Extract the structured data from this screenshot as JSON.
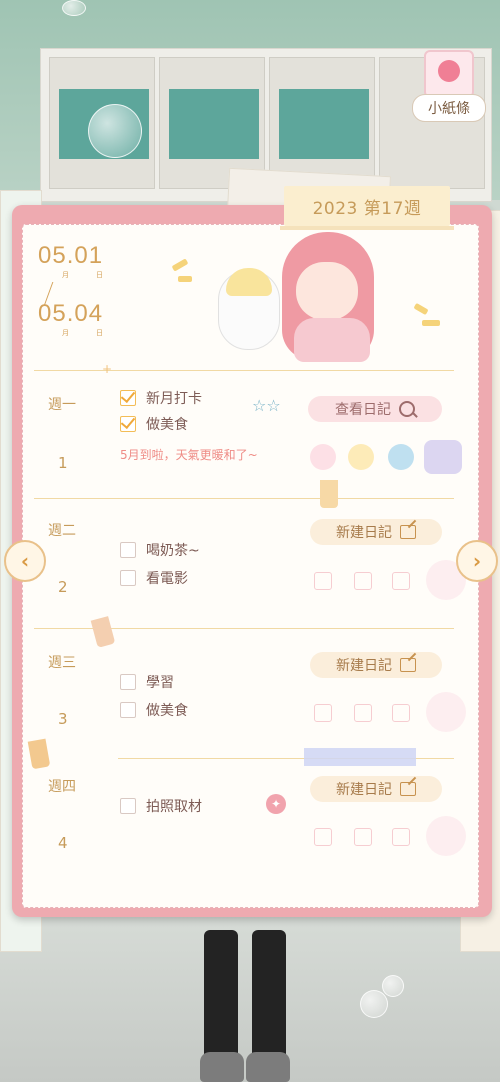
{
  "header": {
    "note_button_label": "小紙條",
    "week_tab": "2023 第17週"
  },
  "dates": {
    "start": "05.01",
    "end": "05.04",
    "month_label": "月",
    "day_label": "日"
  },
  "weeks": [
    {
      "label": "週一",
      "number": "1",
      "tasks": [
        {
          "text": "新月打卡",
          "done": true
        },
        {
          "text": "做美食",
          "done": true
        }
      ],
      "note": "5月到啦，天氣更暖和了~",
      "button": "查看日記",
      "moods": [
        "smile-face-icon",
        "sun-icon",
        "beach-icon",
        "gift-box-icon"
      ]
    },
    {
      "label": "週二",
      "number": "2",
      "tasks": [
        {
          "text": "喝奶茶~",
          "done": false
        },
        {
          "text": "看電影",
          "done": false
        }
      ],
      "button": "新建日記"
    },
    {
      "label": "週三",
      "number": "3",
      "tasks": [
        {
          "text": "學習",
          "done": false
        },
        {
          "text": "做美食",
          "done": false
        }
      ],
      "button": "新建日記"
    },
    {
      "label": "週四",
      "number": "4",
      "tasks": [
        {
          "text": "拍照取材",
          "done": false
        }
      ],
      "button": "新建日記"
    }
  ],
  "nav": {
    "prev_icon": "chevron-left-icon",
    "next_icon": "chevron-right-icon"
  },
  "colors": {
    "accent_gold": "#d4a25a",
    "border_pink": "#eeaab0",
    "note_pink": "#ef8c86"
  }
}
